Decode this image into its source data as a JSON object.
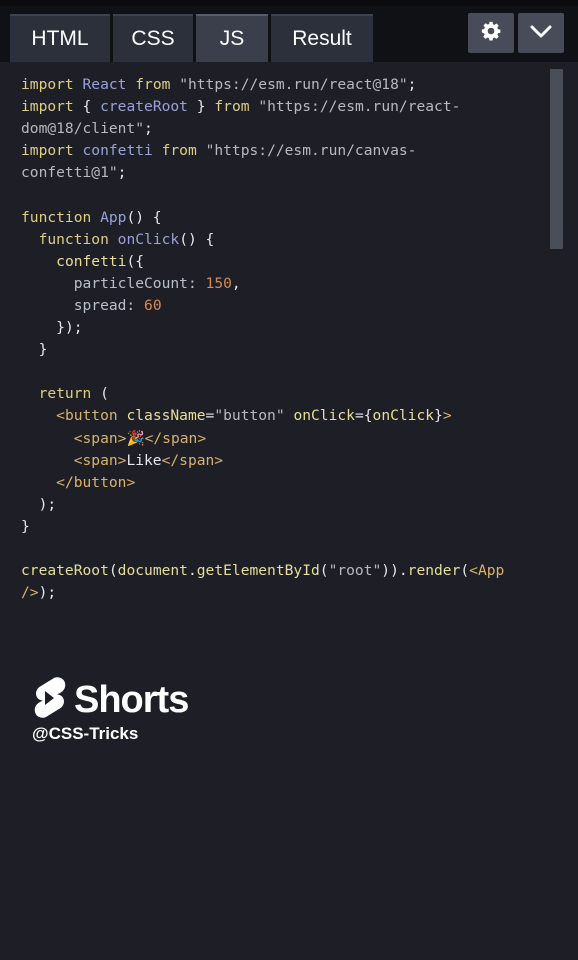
{
  "tabs": [
    {
      "label": "HTML",
      "active": false
    },
    {
      "label": "CSS",
      "active": false
    },
    {
      "label": "JS",
      "active": true
    },
    {
      "label": "Result",
      "active": false
    }
  ],
  "toolbar": {
    "settings_icon": "gear-icon",
    "collapse_icon": "chevron-down-icon"
  },
  "code": {
    "line1": {
      "k1": "import",
      "n1": "React",
      "k2": "from",
      "s1": "\"https://esm.run/react@18\"",
      "p1": ";"
    },
    "line2": {
      "k1": "import",
      "p1": "{",
      "n1": "createRoot",
      "p2": "}",
      "k2": "from",
      "s1": "\"https://esm.run/react-"
    },
    "line3": {
      "s1": "dom@18/client\"",
      "p1": ";"
    },
    "line4": {
      "k1": "import",
      "n1": "confetti",
      "k2": "from",
      "s1": "\"https://esm.run/canvas-"
    },
    "line5": {
      "s1": "confetti@1\"",
      "p1": ";"
    },
    "line7": {
      "k1": "function",
      "n1": "App",
      "p1": "() {"
    },
    "line8": {
      "k1": "function",
      "n1": "onClick",
      "p1": "() {"
    },
    "line9": {
      "f1": "confetti",
      "p1": "({"
    },
    "line10": {
      "pr1": "particleCount:",
      "num1": "150",
      "p1": ","
    },
    "line11": {
      "pr1": "spread:",
      "num1": "60"
    },
    "line12": {
      "p1": "});"
    },
    "line13": {
      "p1": "}"
    },
    "line15": {
      "k1": "return",
      "p1": "("
    },
    "line16": {
      "t1": "<button",
      "a1": "className",
      "p1": "=",
      "s1": "\"button\"",
      "a2": "onClick",
      "p2": "={",
      "a3": "onClick",
      "p3": "}",
      "t2": ">"
    },
    "line17": {
      "t1": "<span>",
      "e1": "🎉",
      "t2": "</span>"
    },
    "line18": {
      "t1": "<span>",
      "x1": "Like",
      "t2": "</span>"
    },
    "line19": {
      "t1": "</button>"
    },
    "line20": {
      "p1": ");"
    },
    "line21": {
      "p1": "}"
    },
    "line23": {
      "f1": "createRoot",
      "p1": "(",
      "f2": "document",
      "p2": ".",
      "f3": "getElementById",
      "p3": "(",
      "s1": "\"root\"",
      "p4": ")).",
      "f4": "render",
      "p5": "(",
      "t1": "<App"
    },
    "line24": {
      "t1": "/>",
      "p1": ");"
    }
  },
  "watermark": {
    "brand": "Shorts",
    "handle": "@CSS-Tricks",
    "logo_icon": "youtube-shorts-icon"
  },
  "colors": {
    "background": "#1e1f26",
    "tab": "#2c303a",
    "tab_active": "#3a3f4b",
    "keyword": "#dccf84",
    "number": "#d88a52"
  }
}
